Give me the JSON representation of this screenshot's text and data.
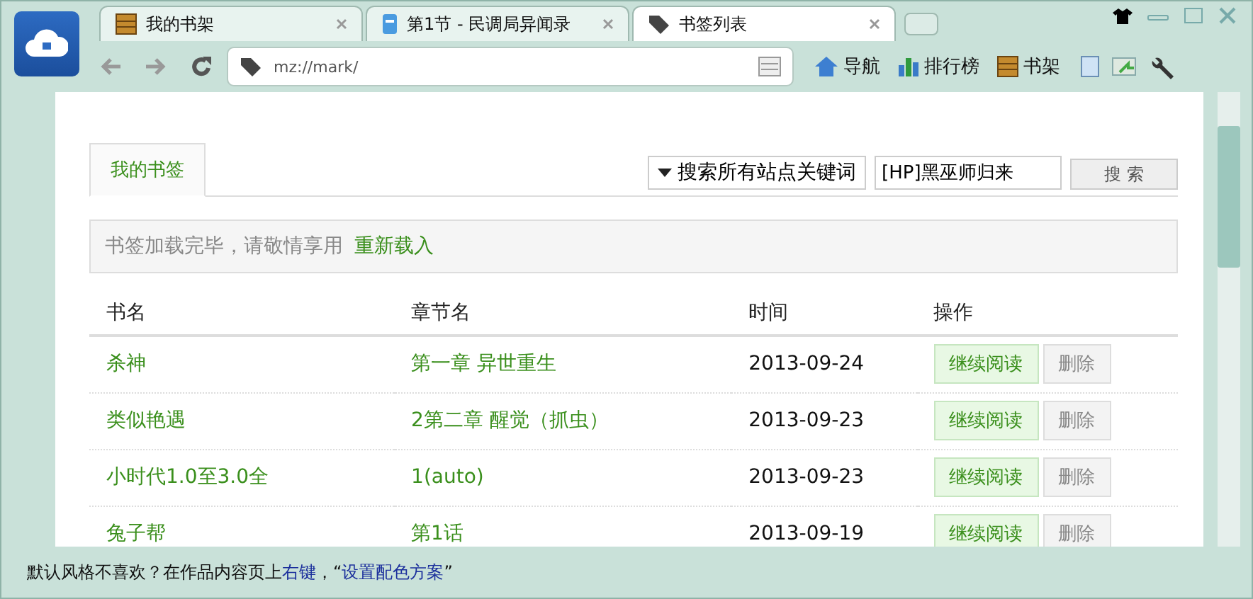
{
  "tabs": [
    {
      "label": "我的书架",
      "selected": false
    },
    {
      "label": "第1节 - 民调局异闻录",
      "selected": false
    },
    {
      "label": "书签列表",
      "selected": true
    }
  ],
  "address": {
    "value": "mz://mark/"
  },
  "toolbar": [
    {
      "label": "导航"
    },
    {
      "label": "排行榜"
    },
    {
      "label": "书架"
    }
  ],
  "bookmark_tab": {
    "label": "我的书签",
    "selected": true
  },
  "search": {
    "scope": "搜索所有站点关键词",
    "value": "[HP]黑巫师归来",
    "button": "搜 索"
  },
  "notice": {
    "text": "书签加载完毕，请敬情享用",
    "link": "重新载入"
  },
  "table": {
    "columns": [
      "书名",
      "章节名",
      "时间",
      "操作"
    ],
    "rows": [
      {
        "book": "杀神",
        "chapter": "第一章 异世重生",
        "time": "2013-09-24",
        "continue": "继续阅读",
        "delete": "删除"
      },
      {
        "book": "类似艳遇",
        "chapter": "2第二章 醒觉（抓虫）",
        "time": "2013-09-23",
        "continue": "继续阅读",
        "delete": "删除"
      },
      {
        "book": "小时代1.0至3.0全",
        "chapter": "1(auto)",
        "time": "2013-09-23",
        "continue": "继续阅读",
        "delete": "删除"
      },
      {
        "book": "兔子帮",
        "chapter": "第1话",
        "time": "2013-09-19",
        "continue": "继续阅读",
        "delete": "删除"
      }
    ]
  },
  "status_bar": [
    {
      "kind": "text",
      "text": "默认风格不喜欢？在作品内容页上"
    },
    {
      "kind": "link",
      "text": "右键"
    },
    {
      "kind": "text",
      "text": "，“"
    },
    {
      "kind": "link",
      "text": "设置配色方案"
    },
    {
      "kind": "text",
      "text": "”"
    }
  ]
}
